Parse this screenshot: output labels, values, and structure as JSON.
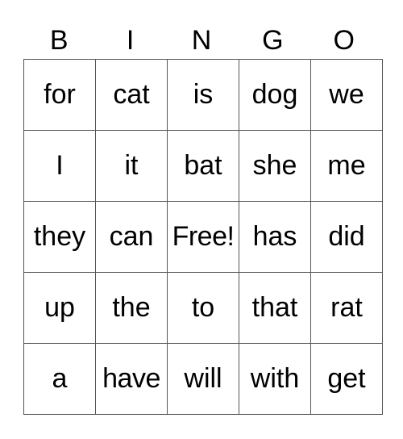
{
  "header": [
    "B",
    "I",
    "N",
    "G",
    "O"
  ],
  "rows": [
    [
      "for",
      "cat",
      "is",
      "dog",
      "we"
    ],
    [
      "I",
      "it",
      "bat",
      "she",
      "me"
    ],
    [
      "they",
      "can",
      "Free!",
      "has",
      "did"
    ],
    [
      "up",
      "the",
      "to",
      "that",
      "rat"
    ],
    [
      "a",
      "have",
      "will",
      "with",
      "get"
    ]
  ]
}
